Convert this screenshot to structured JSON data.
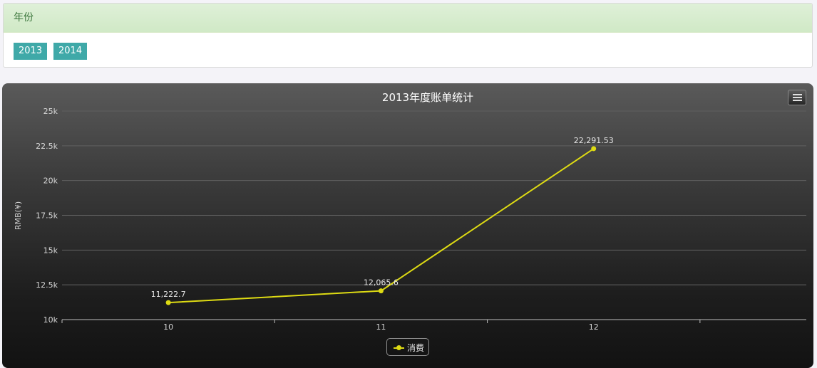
{
  "filter_panel": {
    "heading": "年份",
    "years": [
      "2013",
      "2014"
    ]
  },
  "chart_data": {
    "type": "line",
    "title": "2013年度账单统计",
    "ylabel": "RMB(¥)",
    "xlabel": "",
    "categories": [
      "10",
      "11",
      "12"
    ],
    "series": [
      {
        "name": "消费",
        "values": [
          11222.7,
          12065.6,
          22291.53
        ],
        "labels": [
          "11,222.7",
          "12,065.6",
          "22,291.53"
        ],
        "color": "#dedb13"
      }
    ],
    "ylim": [
      10000,
      25000
    ],
    "yticks": [
      10000,
      12500,
      15000,
      17500,
      20000,
      22500,
      25000
    ],
    "ytick_labels": [
      "10k",
      "12.5k",
      "15k",
      "17.5k",
      "20k",
      "22.5k",
      "25k"
    ],
    "grid": true,
    "legend_position": "bottom-center"
  },
  "colors": {
    "series": "#dedb13",
    "year_button": "#3fa9a8",
    "panel_heading_text": "#3c763d"
  },
  "icons": {
    "menu": "hamburger-menu-icon"
  }
}
